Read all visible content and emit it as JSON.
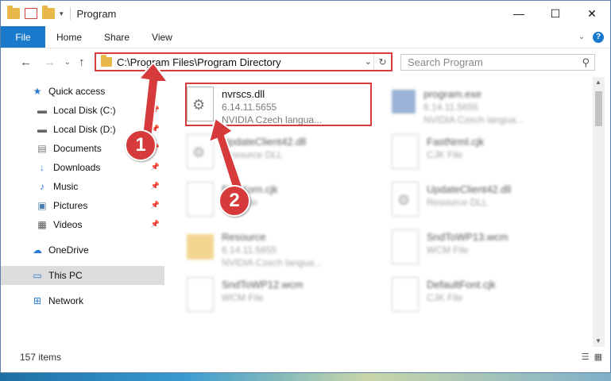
{
  "window": {
    "title": "Program",
    "controls": [
      "—",
      "☐",
      "✕"
    ]
  },
  "ribbon": {
    "file": "File",
    "tabs": [
      "Home",
      "Share",
      "View"
    ]
  },
  "address": {
    "path": "C:\\Program Files\\Program Directory",
    "search_placeholder": "Search Program"
  },
  "sidebar": {
    "items": [
      {
        "label": "Quick access",
        "icon": "star-icon"
      },
      {
        "label": "Local Disk (C:)",
        "icon": "drive-icon",
        "pinned": true
      },
      {
        "label": "Local Disk (D:)",
        "icon": "drive-icon",
        "pinned": true
      },
      {
        "label": "Documents",
        "icon": "documents-icon",
        "pinned": true
      },
      {
        "label": "Downloads",
        "icon": "download-icon",
        "pinned": true
      },
      {
        "label": "Music",
        "icon": "music-icon",
        "pinned": true
      },
      {
        "label": "Pictures",
        "icon": "pictures-icon",
        "pinned": true
      },
      {
        "label": "Videos",
        "icon": "videos-icon",
        "pinned": true
      },
      {
        "label": "OneDrive",
        "icon": "cloud-icon"
      },
      {
        "label": "This PC",
        "icon": "computer-icon",
        "selected": true
      },
      {
        "label": "Network",
        "icon": "network-icon"
      }
    ]
  },
  "files": [
    {
      "name": "nvrscs.dll",
      "line2": "6.14.11.5655",
      "line3": "NVIDIA Czech langua...",
      "type": "dll"
    },
    {
      "name": "program.exe",
      "line2": "6.14.11.5655",
      "line3": "NVIDIA Czech langua...",
      "type": "exe"
    },
    {
      "name": "UpdateClient42.dll",
      "line2": "Resource DLL",
      "line3": "",
      "type": "dll"
    },
    {
      "name": "FastNrml.cjk",
      "line2": "CJK File",
      "line3": "",
      "type": "doc"
    },
    {
      "name": "PerfXorn.cjk",
      "line2": "CJK File",
      "line3": "",
      "type": "doc"
    },
    {
      "name": "UpdateClient42.dll",
      "line2": "Resource DLL",
      "line3": "",
      "type": "dll"
    },
    {
      "name": "Resource",
      "line2": "6.14.11.5655",
      "line3": "NVIDIA Czech langua...",
      "type": "folder"
    },
    {
      "name": "SndToWP13.wcm",
      "line2": "WCM File",
      "line3": "",
      "type": "doc"
    },
    {
      "name": "SndToWP12.wcm",
      "line2": "WCM File",
      "line3": "",
      "type": "doc"
    },
    {
      "name": "DefaultFont.cjk",
      "line2": "CJK File",
      "line3": "",
      "type": "doc"
    }
  ],
  "status": {
    "count": "157 items"
  },
  "annotations": {
    "marker1": "1",
    "marker2": "2",
    "color": "#d73a3a"
  }
}
